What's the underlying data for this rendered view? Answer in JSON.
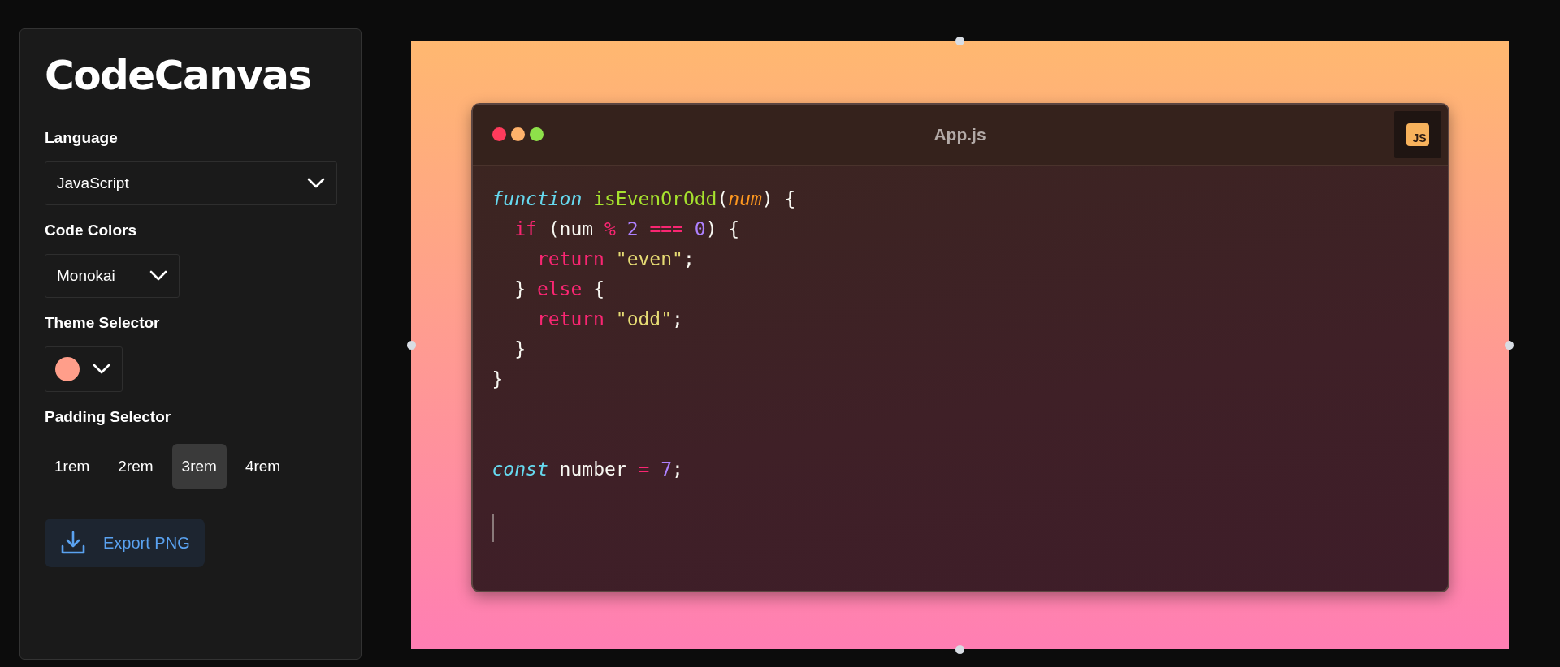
{
  "sidebar": {
    "title": "CodeCanvas",
    "language": {
      "label": "Language",
      "value": "JavaScript"
    },
    "code_colors": {
      "label": "Code Colors",
      "value": "Monokai"
    },
    "theme": {
      "label": "Theme Selector",
      "color": "#ff9e8a"
    },
    "padding": {
      "label": "Padding Selector",
      "options": [
        {
          "label": "1rem",
          "selected": false
        },
        {
          "label": "2rem",
          "selected": false
        },
        {
          "label": "3rem",
          "selected": true
        },
        {
          "label": "4rem",
          "selected": false
        }
      ]
    },
    "export_button": "Export PNG"
  },
  "editor": {
    "title": "App.js",
    "badge": "JS",
    "caret_visible": true,
    "lines": [
      {
        "tokens": [
          {
            "text": "function",
            "kind": "storage"
          },
          {
            "text": " isEvenOrOdd",
            "kind": "function"
          },
          {
            "text": "(",
            "kind": "plain"
          },
          {
            "text": "num",
            "kind": "param"
          },
          {
            "text": ") {",
            "kind": "plain"
          }
        ]
      },
      {
        "tokens": [
          {
            "text": "  if",
            "kind": "keyword"
          },
          {
            "text": " (num ",
            "kind": "plain"
          },
          {
            "text": "%",
            "kind": "keyword"
          },
          {
            "text": " 2 ",
            "kind": "number"
          },
          {
            "text": "===",
            "kind": "keyword"
          },
          {
            "text": " 0",
            "kind": "number"
          },
          {
            "text": ") {",
            "kind": "plain"
          }
        ]
      },
      {
        "tokens": [
          {
            "text": "    return",
            "kind": "keyword"
          },
          {
            "text": " \"even\"",
            "kind": "string"
          },
          {
            "text": ";",
            "kind": "plain"
          }
        ]
      },
      {
        "tokens": [
          {
            "text": "  } ",
            "kind": "plain"
          },
          {
            "text": "else",
            "kind": "keyword"
          },
          {
            "text": " {",
            "kind": "plain"
          }
        ]
      },
      {
        "tokens": [
          {
            "text": "    return",
            "kind": "keyword"
          },
          {
            "text": " \"odd\"",
            "kind": "string"
          },
          {
            "text": ";",
            "kind": "plain"
          }
        ]
      },
      {
        "tokens": [
          {
            "text": "  }",
            "kind": "plain"
          }
        ]
      },
      {
        "tokens": [
          {
            "text": "}",
            "kind": "plain"
          }
        ]
      },
      {
        "tokens": [
          {
            "text": "const",
            "kind": "storage"
          },
          {
            "text": " number ",
            "kind": "plain"
          },
          {
            "text": "=",
            "kind": "keyword"
          },
          {
            "text": " 7",
            "kind": "number"
          },
          {
            "text": ";",
            "kind": "plain"
          }
        ]
      }
    ]
  }
}
